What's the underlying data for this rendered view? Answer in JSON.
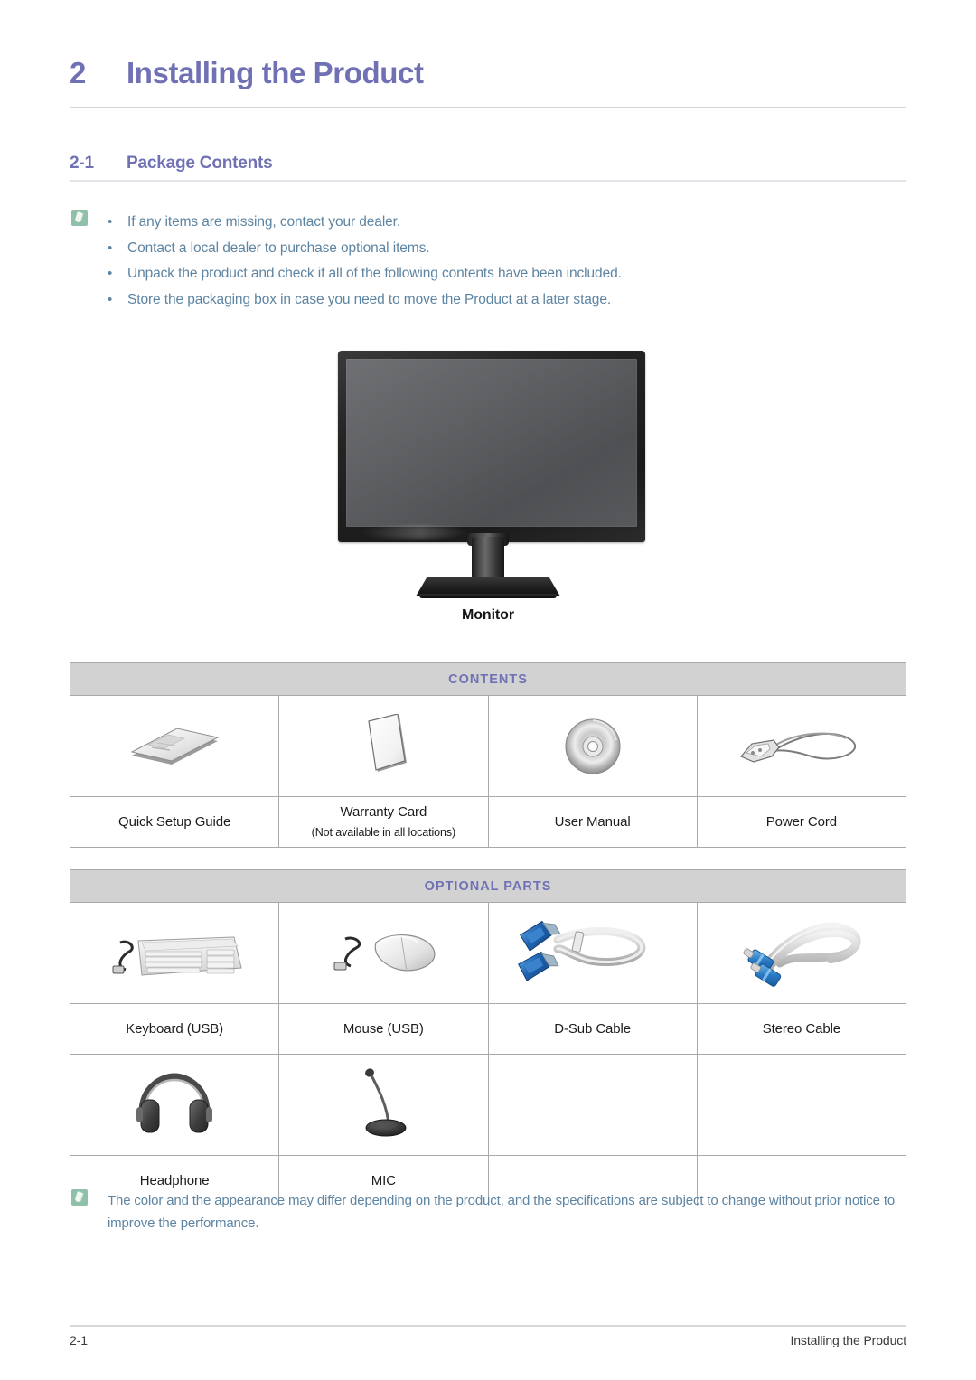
{
  "chapter": {
    "number": "2",
    "title": "Installing the Product"
  },
  "section": {
    "number": "2-1",
    "title": "Package Contents"
  },
  "note_top": {
    "icon": "note-icon",
    "bullet": "•",
    "items": [
      "If any items are missing, contact your dealer.",
      "Contact a local dealer to purchase optional items.",
      "Unpack the product and check if all of the following contents have been included.",
      "Store the packaging box in case you need to move the Product at a later stage."
    ]
  },
  "monitor": {
    "label": "Monitor",
    "icon": "monitor-icon"
  },
  "contents_table": {
    "header": "CONTENTS",
    "items": [
      {
        "icon": "booklet-icon",
        "label": "Quick Setup Guide",
        "sublabel": ""
      },
      {
        "icon": "card-icon",
        "label": "Warranty Card",
        "sublabel": "(Not available in all locations)"
      },
      {
        "icon": "cd-disc-icon",
        "label": "User Manual",
        "sublabel": ""
      },
      {
        "icon": "power-cord-icon",
        "label": "Power Cord",
        "sublabel": ""
      }
    ]
  },
  "optional_table": {
    "header": "OPTIONAL PARTS",
    "rows": [
      [
        {
          "icon": "keyboard-icon",
          "label": "Keyboard (USB)"
        },
        {
          "icon": "mouse-icon",
          "label": "Mouse (USB)"
        },
        {
          "icon": "d-sub-cable-icon",
          "label": "D-Sub Cable"
        },
        {
          "icon": "stereo-cable-icon",
          "label": "Stereo Cable"
        }
      ],
      [
        {
          "icon": "headphone-icon",
          "label": "Headphone"
        },
        {
          "icon": "microphone-icon",
          "label": "MIC"
        },
        {
          "icon": "",
          "label": ""
        },
        {
          "icon": "",
          "label": ""
        }
      ]
    ]
  },
  "note_bottom": {
    "icon": "note-icon",
    "text": "The color and the appearance may differ depending on the product, and the specifications are subject to change without prior notice to improve the performance."
  },
  "footer": {
    "page": "2-1",
    "chapter_label": "Installing the Product"
  },
  "colors": {
    "heading": "#6f71b4",
    "body_note": "#5d84a2",
    "table_header_bg": "#d2d2d2",
    "note_icon_bg": "#8fc0a9",
    "accent_blue_connector": "#2f6fb5"
  }
}
